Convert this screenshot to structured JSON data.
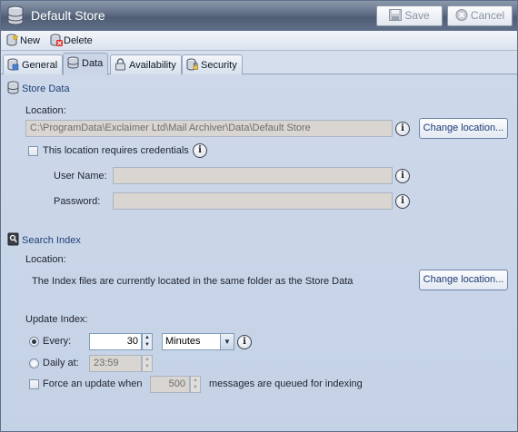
{
  "window": {
    "title": "Default Store"
  },
  "header_buttons": {
    "save": "Save",
    "cancel": "Cancel"
  },
  "toolbar": {
    "new": "New",
    "delete": "Delete"
  },
  "tabs": [
    {
      "label": "General",
      "icon": "general-icon"
    },
    {
      "label": "Data",
      "icon": "database-icon",
      "active": true
    },
    {
      "label": "Availability",
      "icon": "lock-icon"
    },
    {
      "label": "Security",
      "icon": "security-icon"
    }
  ],
  "store_data": {
    "heading": "Store Data",
    "location_label": "Location:",
    "location_value": "C:\\ProgramData\\Exclaimer Ltd\\Mail Archiver\\Data\\Default Store",
    "change_location": "Change location...",
    "credentials_label": "This location requires credentials",
    "user_name_label": "User Name:",
    "user_name_value": "",
    "password_label": "Password:",
    "password_value": ""
  },
  "search_index": {
    "heading": "Search Index",
    "location_label": "Location:",
    "location_text": "The Index files are currently located in the same folder as the Store Data",
    "change_location": "Change location...",
    "update_label": "Update Index:",
    "every_label": "Every:",
    "every_value": "30",
    "interval_unit": "Minutes",
    "daily_label": "Daily at:",
    "daily_value": "23:59",
    "force_label": "Force an update when",
    "force_value": "500",
    "force_suffix": "messages are queued for indexing"
  },
  "colors": {
    "titlebar": "#5f6d84",
    "panel": "#c9d6e9",
    "accent_text": "#1f3f78"
  }
}
